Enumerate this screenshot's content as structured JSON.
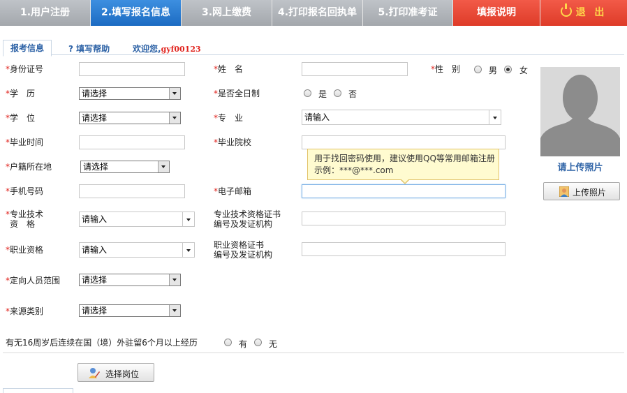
{
  "steps": [
    {
      "label": "1.用户注册"
    },
    {
      "label": "2.填写报名信息"
    },
    {
      "label": "3.网上缴费"
    },
    {
      "label": "4.打印报名回执单"
    },
    {
      "label": "5.打印准考证"
    },
    {
      "label": "填报说明"
    },
    {
      "label": "退 出"
    }
  ],
  "tabs": {
    "info": "报考信息",
    "help": "? 填写帮助",
    "welcome": "欢迎您,",
    "username": "gyf00123"
  },
  "required_mark": "*",
  "form": {
    "id_card": "身份证号",
    "name": "姓　名",
    "gender": "性　别",
    "gender_male": "男",
    "gender_female": "女",
    "education": "学　历",
    "fulltime": "是否全日制",
    "yes": "是",
    "no": "否",
    "degree": "学　位",
    "major": "专　业",
    "grad_time": "毕业时间",
    "grad_school": "毕业院校",
    "hukou": "户籍所在地",
    "mobile": "手机号码",
    "email": "电子邮箱",
    "tech_qual_l1": "专业技术",
    "tech_qual_l2": "资　格",
    "tech_cert_l1": "专业技术资格证书",
    "tech_cert_l2": "编号及发证机构",
    "job_qual": "职业资格",
    "job_cert_l1": "职业资格证书",
    "job_cert_l2": "编号及发证机构",
    "target_scope": "定向人员范围",
    "source_type": "来源类别",
    "abroad": "有无16周岁后连续在国（境）外驻留6个月以上经历",
    "has": "有",
    "none": "无"
  },
  "placeholders": {
    "select": "请选择",
    "input": "请输入"
  },
  "tooltip": {
    "line1": "用于找回密码使用，建议使用QQ等常用邮箱注册",
    "line2": "示例：***@***.com"
  },
  "photo": {
    "prompt": "请上传照片",
    "upload_button": "上传照片"
  },
  "select_position_button": "选择岗位",
  "colors": {
    "step_active": "#1c6bc2",
    "step_inactive": "#a3a7ac",
    "step_red": "#de3b28",
    "required": "#e1241e",
    "link_blue": "#2d62a6"
  }
}
